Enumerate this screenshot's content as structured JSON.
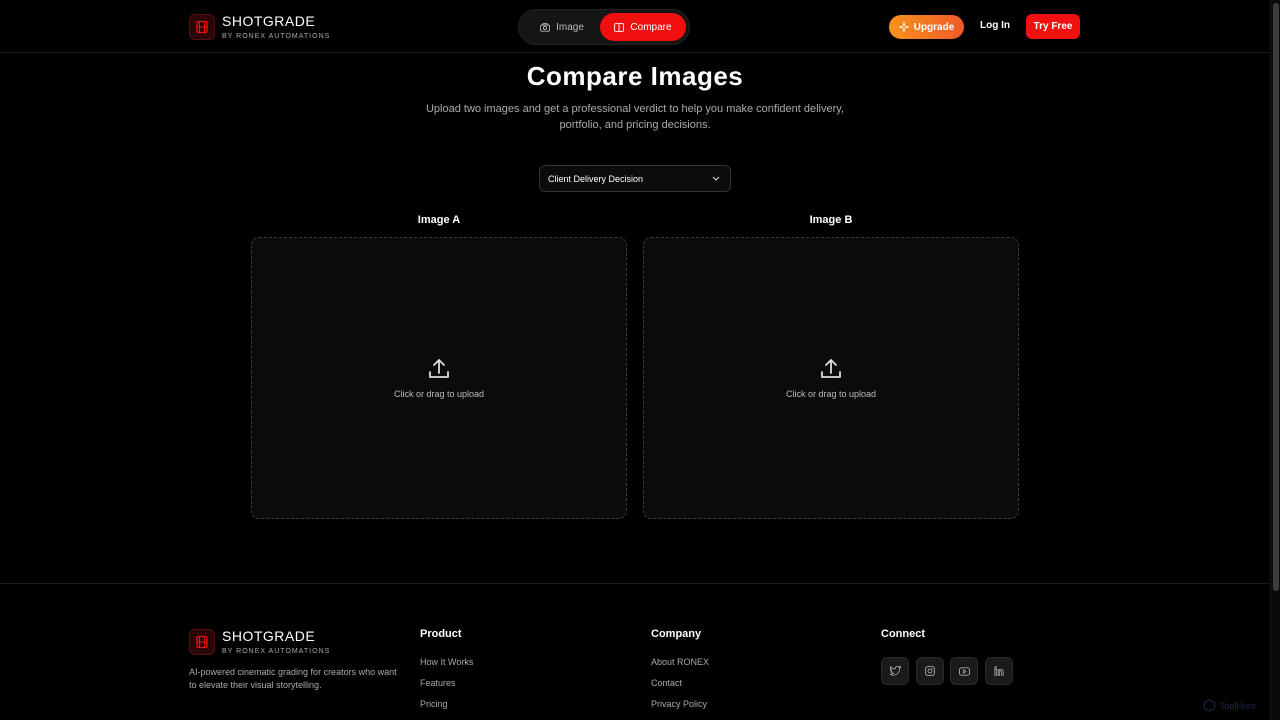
{
  "header": {
    "brand_name": "SHOTGRADE",
    "brand_sub": "BY RONEX AUTOMATIONS",
    "mode_image": "Image",
    "mode_compare": "Compare",
    "upgrade_label": "Upgrade",
    "login_label": "Log In",
    "try_free_label": "Try Free"
  },
  "main": {
    "title": "Compare Images",
    "subtitle": "Upload two images and get a professional verdict to help you make confident delivery, portfolio, and pricing decisions.",
    "select_value": "Client Delivery Decision",
    "panel_a_label": "Image A",
    "panel_b_label": "Image B",
    "upload_hint": "Click or drag to upload"
  },
  "footer": {
    "brand_name": "SHOTGRADE",
    "brand_sub": "BY RONEX AUTOMATIONS",
    "description": "AI-powered cinematic grading for creators who want to elevate their visual storytelling.",
    "product_heading": "Product",
    "product_links": [
      "How It Works",
      "Features",
      "Pricing"
    ],
    "company_heading": "Company",
    "company_links": [
      "About RONEX",
      "Contact",
      "Privacy Policy"
    ],
    "connect_heading": "Connect",
    "social_icons": [
      "twitter-icon",
      "instagram-icon",
      "youtube-icon",
      "linkedin-icon"
    ]
  },
  "watermark": "ToolHunt",
  "colors": {
    "accent_red": "#f01010",
    "upgrade_gradient_start": "#f7931e",
    "upgrade_gradient_end": "#f05a28",
    "background": "#000000"
  }
}
